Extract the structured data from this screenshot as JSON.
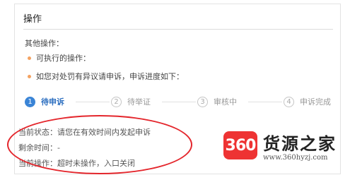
{
  "panel": {
    "title": "操作",
    "other_ops_label": "其他操作：",
    "bullets": [
      "可执行的操作：",
      "如您对处罚有异议请申诉，申诉进度如下："
    ]
  },
  "steps": [
    {
      "num": "1",
      "label": "待申诉",
      "active": true
    },
    {
      "num": "2",
      "label": "待举证",
      "active": false
    },
    {
      "num": "3",
      "label": "审核中",
      "active": false
    },
    {
      "num": "4",
      "label": "申诉完成",
      "active": false
    }
  ],
  "status": {
    "current_state": "当前状态：请您在有效时间内发起申诉",
    "remaining_time": "剩余时间：-",
    "current_action": "当前操作：超时未操作，入口关闭"
  },
  "annotation": {
    "color": "#e4262c"
  },
  "watermark": {
    "logo": "360",
    "title": "货源之家",
    "url": "www.360hyzj.com"
  },
  "colors": {
    "accent": "#3a84d6",
    "bullet": "#f4a261"
  }
}
